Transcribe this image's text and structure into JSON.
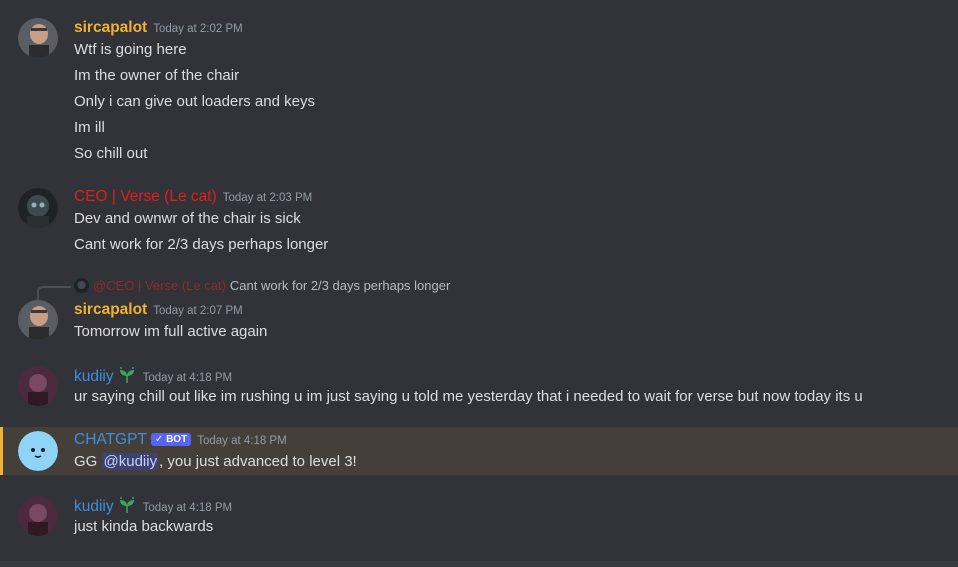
{
  "colors": {
    "background": "#313338",
    "sircapalot": "#f0b232",
    "ceo": "#e01e1e",
    "kudiiy": "#3b8fe0",
    "chatgpt": "#3b8fe0",
    "highlight": "#444039",
    "highlight_border": "#f0b232"
  },
  "messages": [
    {
      "author": "sircapalot",
      "time": "Today at 2:02 PM",
      "lines": [
        "Wtf is going here",
        "Im the owner of the chair",
        "Only i can give out loaders and keys",
        "Im ill",
        "So chill out"
      ]
    },
    {
      "author": "CEO | Verse (Le cat)",
      "time": "Today at 2:03 PM",
      "lines": [
        "Dev and ownwr of the chair is sick",
        "Cant work for 2/3 days perhaps longer"
      ]
    },
    {
      "reply": {
        "mention": "@CEO | Verse (Le cat)",
        "text": "Cant work for 2/3 days perhaps longer"
      },
      "author": "sircapalot",
      "time": "Today at 2:07 PM",
      "lines": [
        "Tomorrow im full active again"
      ]
    },
    {
      "author": "kudiiy",
      "badge_icon": "leaf-badge-icon",
      "time": "Today at 4:18 PM",
      "lines": [
        "ur saying chill out like im rushing u im just saying u told me yesterday that i needed to wait for verse but now today its u"
      ]
    },
    {
      "author": "CHATGPT",
      "tag": "BOT",
      "tag_icon": "checkmark-icon",
      "time": "Today at 4:18 PM",
      "text_before": "GG ",
      "mention": "@kudiiy",
      "text_after": ", you just advanced to level 3!"
    },
    {
      "author": "kudiiy",
      "badge_icon": "leaf-badge-icon",
      "time": "Today at 4:18 PM",
      "lines": [
        "just kinda backwards"
      ]
    }
  ]
}
